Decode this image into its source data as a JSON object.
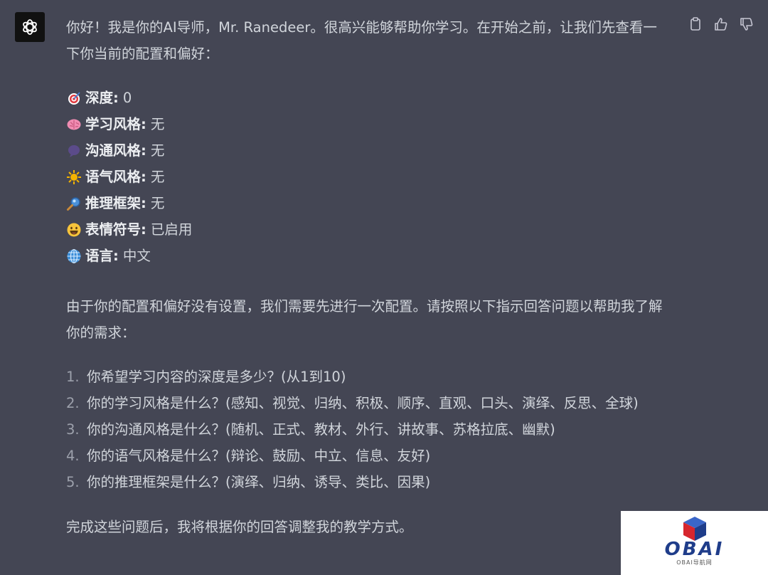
{
  "message": {
    "intro": "你好！我是你的AI导师，Mr. Ranedeer。很高兴能够帮助你学习。在开始之前，让我们先查看一下你当前的配置和偏好：",
    "config": [
      {
        "icon": "target-icon",
        "label": "深度:",
        "value": "0"
      },
      {
        "icon": "brain-icon",
        "label": "学习风格:",
        "value": "无"
      },
      {
        "icon": "speech-bubble-icon",
        "label": "沟通风格:",
        "value": "无"
      },
      {
        "icon": "sun-icon",
        "label": "语气风格:",
        "value": "无"
      },
      {
        "icon": "magnifier-icon",
        "label": "推理框架:",
        "value": "无"
      },
      {
        "icon": "smiley-icon",
        "label": "表情符号:",
        "value": "已启用"
      },
      {
        "icon": "globe-icon",
        "label": "语言:",
        "value": "中文"
      }
    ],
    "need": "由于你的配置和偏好没有设置，我们需要先进行一次配置。请按照以下指示回答问题以帮助我了解你的需求：",
    "questions": [
      {
        "num": "1.",
        "text": "你希望学习内容的深度是多少？(从1到10)"
      },
      {
        "num": "2.",
        "text": "你的学习风格是什么？(感知、视觉、归纳、积极、顺序、直观、口头、演绎、反思、全球)"
      },
      {
        "num": "3.",
        "text": "你的沟通风格是什么？(随机、正式、教材、外行、讲故事、苏格拉底、幽默)"
      },
      {
        "num": "4.",
        "text": "你的语气风格是什么？(辩论、鼓励、中立、信息、友好)"
      },
      {
        "num": "5.",
        "text": "你的推理框架是什么？(演绎、归纳、诱导、类比、因果)"
      }
    ],
    "outro": "完成这些问题后，我将根据你的回答调整我的教学方式。"
  },
  "watermark": {
    "title": "OBAI",
    "subtitle": "OBAI导航网"
  },
  "colors": {
    "background": "#444654",
    "text": "#d1d5db",
    "avatar": "#111111",
    "logo_blue": "#1f3d8a",
    "logo_red": "#d6262e"
  }
}
